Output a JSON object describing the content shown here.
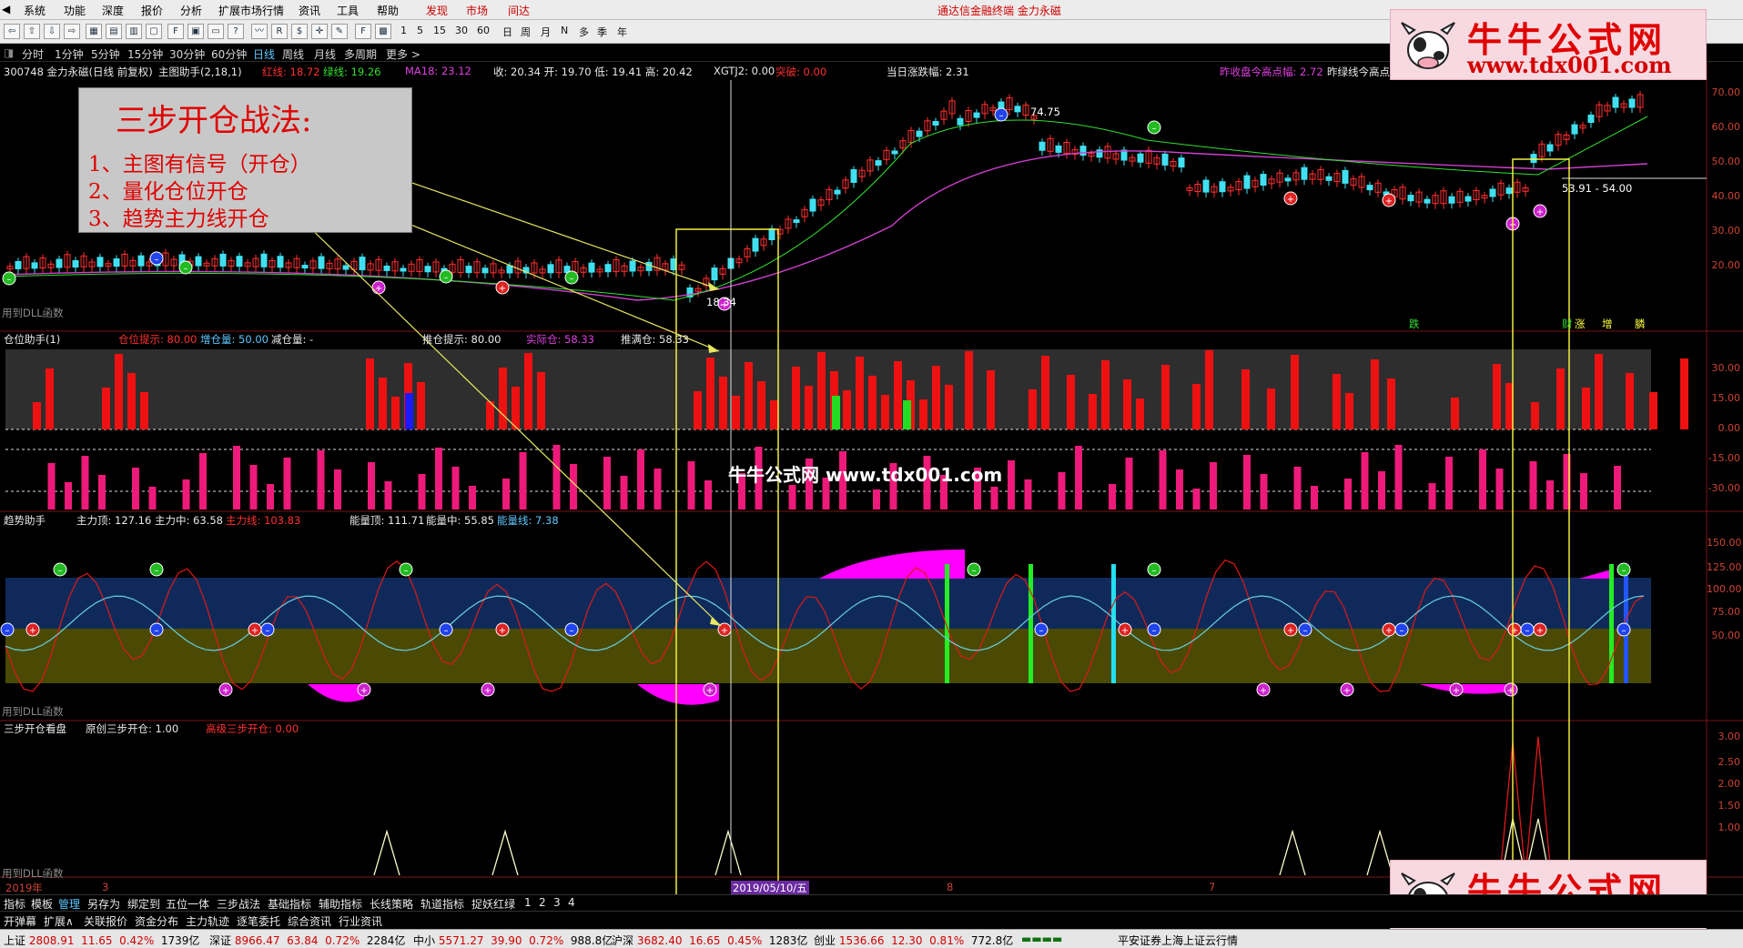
{
  "menu": [
    "系统",
    "功能",
    "深度",
    "报价",
    "分析",
    "扩展市场行情",
    "资讯",
    "工具",
    "帮助"
  ],
  "menu_extra": [
    "发现",
    "市场",
    "间达"
  ],
  "app_title": "通达信金融终端  金力永磁",
  "toolbar_labels": [
    "1",
    "5",
    "15",
    "30",
    "60",
    "日",
    "周",
    "月",
    "N",
    "多",
    "季",
    "年"
  ],
  "periods": [
    "分时",
    "1分钟",
    "5分钟",
    "15分钟",
    "30分钟",
    "60分钟",
    "日线",
    "周线",
    "月线",
    "多周期",
    "更多 >"
  ],
  "active_period": "日线",
  "main_header": {
    "stock": "300748 金力永磁(日线 前复权)",
    "indicator": "主图助手(2,18,1)",
    "red_line": "红线: 18.72",
    "green_line": "绿线: 19.26",
    "ma18": "MA18: 23.12",
    "quote": "收: 20.34  开: 19.70  低: 19.41  高: 20.42",
    "xgtj": "XGTJ2: 0.00",
    "break": "突破: 0.00",
    "daily_change": "当日涨跌幅: 2.31",
    "prev_close_high": "昨收盘今高点幅: 2.72",
    "prev_green_high": "昨绿线今高点"
  },
  "price_axis": [
    "70.00",
    "60.00",
    "50.00",
    "40.00",
    "30.00",
    "20.00"
  ],
  "price_labels": {
    "high": "74.75",
    "low": "18.34",
    "range": "53.91 - 54.00"
  },
  "dll_label": "用到DLL函数",
  "signal_words": [
    "跌",
    "财",
    "涨",
    "增",
    "膦"
  ],
  "pane2_header": {
    "name": "仓位助手(1)",
    "pos_hint": "仓位提示: 80.00",
    "add": "增仓量: 50.00",
    "reduce": "减仓量: -",
    "push_hint": "推仓提示: 80.00",
    "actual": "实际仓: 58.33",
    "full": "推满仓: 58.33"
  },
  "pane2_axis": [
    "30.00",
    "15.00",
    "0.00",
    "-15.00",
    "-30.00"
  ],
  "pane3_header": {
    "name": "趋势助手",
    "main_top": "主力顶: 127.16",
    "main_mid": "主力中: 63.58",
    "main_line": "主力线: 103.83",
    "energy_top": "能量顶: 111.71",
    "energy_mid": "能量中: 55.85",
    "energy_line": "能量线: 7.38"
  },
  "pane3_axis": [
    "150.00",
    "125.00",
    "100.00",
    "75.00",
    "50.00"
  ],
  "pane4_header": {
    "name": "三步开仓看盘",
    "orig": "原创三步开仓: 1.00",
    "adv": "高级三步开仓: 0.00"
  },
  "pane4_axis": [
    "3.00",
    "2.50",
    "2.00",
    "1.50",
    "1.00"
  ],
  "date_bar": {
    "year": "2019年",
    "date": "2019/05/10/五",
    "m3": "3",
    "m8": "8",
    "m7": "7"
  },
  "annotation": {
    "title": "三步开仓战法:",
    "lines": [
      "1、主图有信号（开仓）",
      "2、量化仓位开仓",
      "3、趋势主力线开仓"
    ]
  },
  "watermark": {
    "title": "牛牛公式网",
    "url": "www.tdx001.com"
  },
  "center_watermark": "牛牛公式网 www.tdx001.com",
  "tabs1": [
    "指标",
    "模板",
    "管理",
    "另存为",
    "绑定到",
    "五位一体",
    "三步战法",
    "基础指标",
    "辅助指标",
    "长线策略",
    "轨道指标",
    "捉妖红绿",
    "1",
    "2",
    "3",
    "4"
  ],
  "tabs2": [
    "开弹幕",
    "扩展∧",
    "关联报价",
    "资金分布",
    "主力轨迹",
    "逐笔委托",
    "综合资讯",
    "行业资讯"
  ],
  "status": [
    {
      "name": "上证",
      "price": "2808.91",
      "chg": "11.65",
      "pct": "0.42%",
      "amt": "1739亿"
    },
    {
      "name": "深证",
      "price": "8966.47",
      "chg": "63.84",
      "pct": "0.72%",
      "amt": "2284亿"
    },
    {
      "name": "中小",
      "price": "5571.27",
      "chg": "39.90",
      "pct": "0.72%",
      "amt": "988.8亿"
    },
    {
      "name": "沪深",
      "price": "3682.40",
      "chg": "16.65",
      "pct": "0.45%",
      "amt": "1283亿"
    },
    {
      "name": "创业",
      "price": "1536.66",
      "chg": "12.30",
      "pct": "0.81%",
      "amt": "772.8亿"
    }
  ],
  "status_right": "平安证券上海上证云行情",
  "colors": {
    "bg": "#000000",
    "up": "#ff3030",
    "down": "#40e0f0",
    "magenta": "#ff00ff",
    "yellow": "#ffff60",
    "navy": "#0f2a5a",
    "olive": "#4a4a05"
  }
}
